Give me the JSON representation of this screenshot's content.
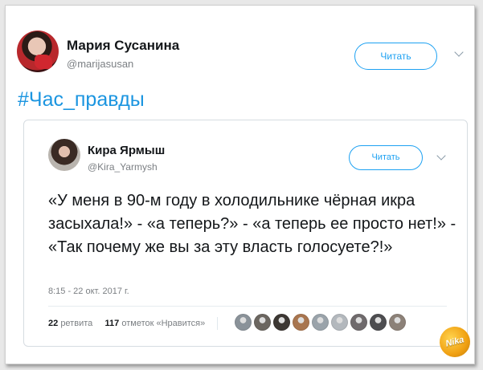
{
  "tweet": {
    "author_name": "Мария Сусанина",
    "author_handle": "@marijasusan",
    "follow_label": "Читать",
    "text": "#Час_правды"
  },
  "quoted_tweet": {
    "author_name": "Кира Ярмыш",
    "author_handle": "@Kira_Yarmysh",
    "follow_label": "Читать",
    "text": "«У меня в 90-м году в холодильнике чёрная икра засыхала!» - «а теперь?» - «а теперь ее просто нет!» - «Так почему же вы за эту власть голосуете?!»",
    "timestamp": "8:15 - 22 окт. 2017 г.",
    "retweets_count": "22",
    "retweets_label": "ретвита",
    "likes_count": "117",
    "likes_label": "отметок «Нравится»",
    "liker_avatar_colors": [
      "#8a9299",
      "#6b6660",
      "#3c3733",
      "#a8754f",
      "#9aa3aa",
      "#b3b8bd",
      "#6f6a6c",
      "#4d4d50",
      "#8c8178"
    ]
  },
  "watermark": {
    "label": "Nika"
  },
  "colors": {
    "accent": "#1da1f2",
    "hashtag": "#1b95e0",
    "muted_text": "#7b7f83"
  }
}
